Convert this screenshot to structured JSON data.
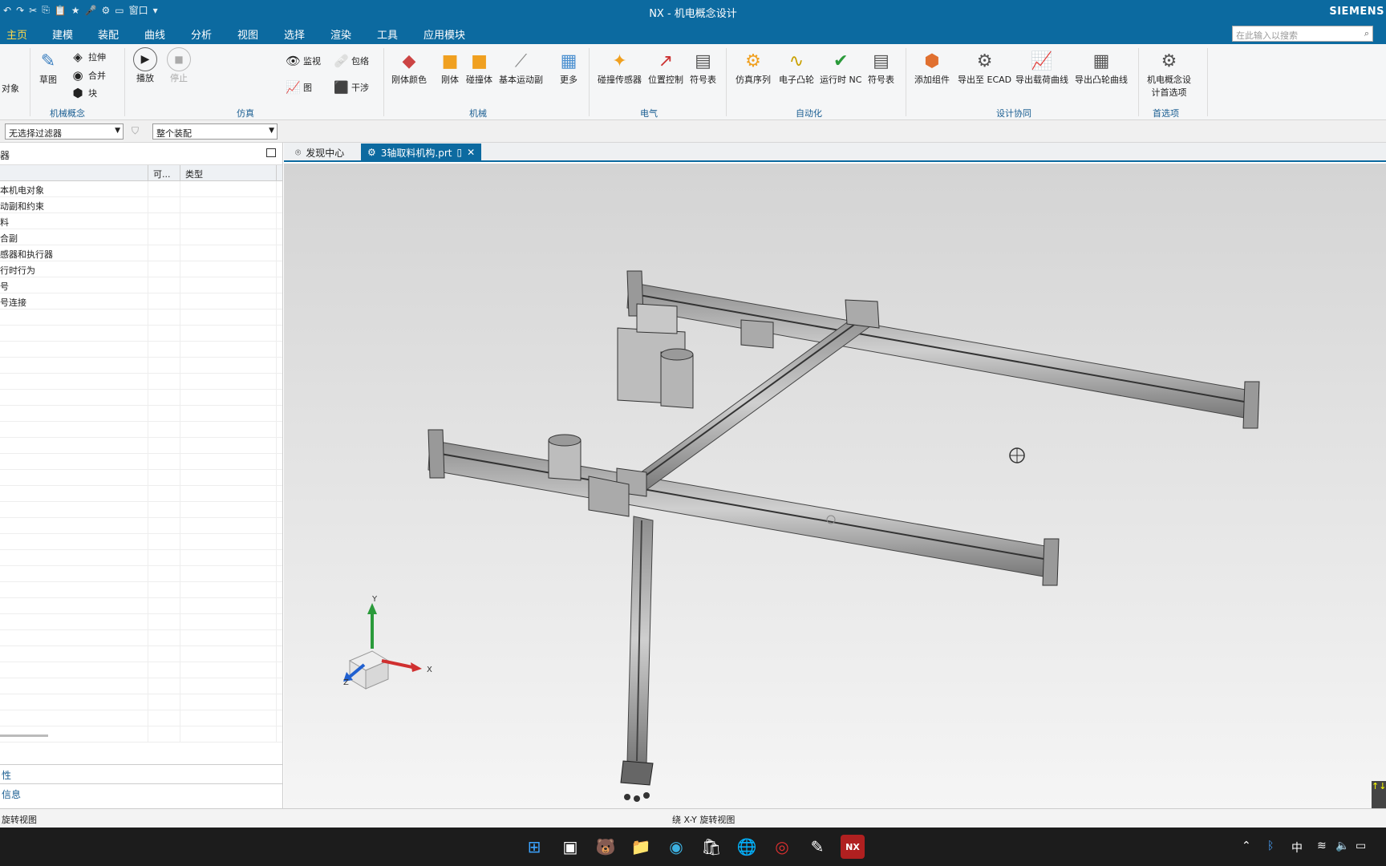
{
  "window": {
    "title": "NX - 机电概念设计",
    "brand": "SIEMENS",
    "quick_access_window": "窗口"
  },
  "menu": {
    "tabs": [
      "主页",
      "建模",
      "装配",
      "曲线",
      "分析",
      "视图",
      "选择",
      "渲染",
      "工具",
      "应用模块"
    ],
    "active": "主页"
  },
  "search": {
    "placeholder": "在此输入以搜索"
  },
  "ribbon": {
    "partial_left": {
      "item1": "对象"
    },
    "mech_concept": {
      "sketch": "草图",
      "extrude": "拉伸",
      "unite": "合并",
      "block": "块",
      "group": "机械概念"
    },
    "simulation": {
      "play": "播放",
      "stop": "停止",
      "monitor": "监视",
      "wrap": "包络",
      "graph": "图",
      "interfere": "干涉",
      "group": "仿真"
    },
    "mechanical": {
      "items": [
        "刚体颜色",
        "刚体",
        "碰撞体",
        "基本运动副",
        "更多"
      ],
      "group": "机械"
    },
    "electrical": {
      "items": [
        "碰撞传感器",
        "位置控制",
        "符号表"
      ],
      "group": "电气"
    },
    "automation": {
      "items": [
        "仿真序列",
        "电子凸轮",
        "运行时 NC",
        "符号表"
      ],
      "group": "自动化"
    },
    "design_collab": {
      "items": [
        "添加组件",
        "导出至 ECAD",
        "导出载荷曲线",
        "导出凸轮曲线"
      ],
      "group": "设计协同"
    },
    "preferences": {
      "item_line1": "机电概念设",
      "item_line2": "计首选项",
      "group": "首选项"
    }
  },
  "filterbar": {
    "selection_filter": "无选择过滤器",
    "scope": "整个装配"
  },
  "navigator": {
    "title": "器",
    "columns": [
      "",
      "可...",
      "类型"
    ],
    "rows": [
      "本机电对象",
      "动副和约束",
      "料",
      "合副",
      "感器和执行器",
      "行时行为",
      "号",
      "号连接"
    ],
    "footer": [
      "性",
      "信息"
    ]
  },
  "tabs": [
    {
      "label": "发现中心",
      "active": false
    },
    {
      "label": "3轴取料机构.prt",
      "active": true
    }
  ],
  "triad": {
    "x": "X",
    "y": "Y",
    "z": "Z"
  },
  "status": {
    "left": "旋转视图",
    "center": "绕 X-Y 旋转视图"
  },
  "taskbar": {
    "ime": "中"
  },
  "colors": {
    "accent": "#0c6aa0",
    "active_tab": "#ffd84a",
    "group_label": "#1a5e92"
  }
}
